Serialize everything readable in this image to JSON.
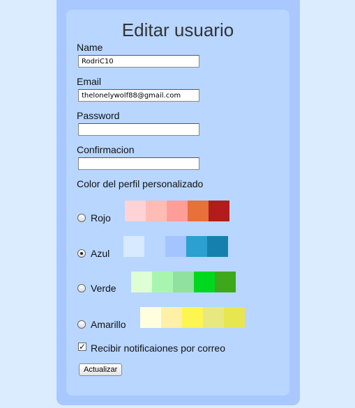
{
  "title": "Editar usuario",
  "fields": {
    "name": {
      "label": "Name",
      "value": "RodriC10"
    },
    "email": {
      "label": "Email",
      "value": "thelonelywolf88@gmail.com"
    },
    "password": {
      "label": "Password",
      "value": ""
    },
    "confirm": {
      "label": "Confirmacion",
      "value": ""
    }
  },
  "profile_color_heading": "Color del perfil personalizado",
  "color_options": [
    {
      "label": "Rojo",
      "selected": false,
      "swatches": [
        "#ffd2d6",
        "#ffbcb5",
        "#ff9e98",
        "#e8703b",
        "#b31c1c"
      ]
    },
    {
      "label": "Azul",
      "selected": true,
      "swatches": [
        "#d8eaff",
        "#b8d6ff",
        "#a3c4ff",
        "#2ca0d0",
        "#1680ac"
      ]
    },
    {
      "label": "Verde",
      "selected": false,
      "swatches": [
        "#deffd6",
        "#a8f5b0",
        "#90e0a0",
        "#00d81e",
        "#3da81c"
      ]
    },
    {
      "label": "Amarillo",
      "selected": false,
      "swatches": [
        "#ffffe0",
        "#fff0a8",
        "#fff550",
        "#e8e880",
        "#e8e650"
      ]
    }
  ],
  "notify": {
    "label": "Recibir notificaiones por correo",
    "checked": true
  },
  "submit_label": "Actualizar"
}
